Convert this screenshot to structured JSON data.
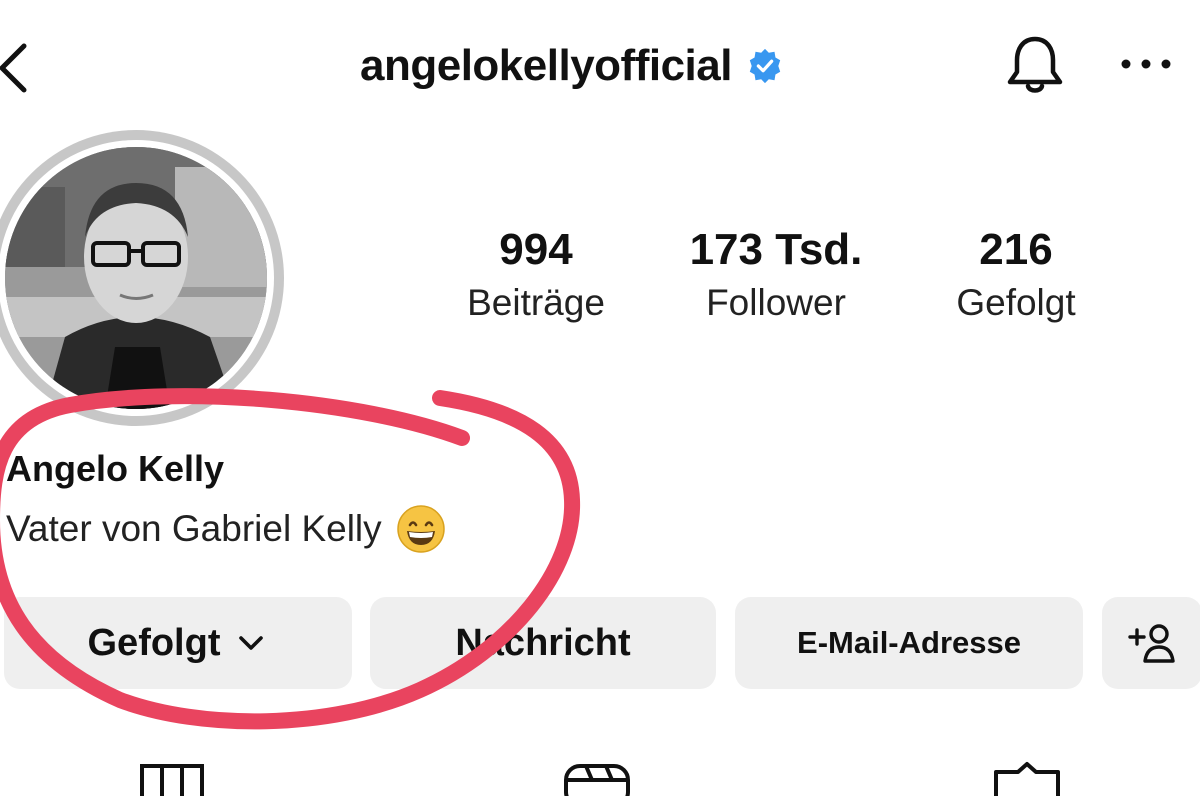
{
  "header": {
    "username": "angelokellyofficial",
    "icons": [
      "back-icon",
      "verified-badge-icon",
      "bell-icon",
      "more-icon"
    ]
  },
  "stats": [
    {
      "value": "994",
      "label": "Beiträge"
    },
    {
      "value": "173 Tsd.",
      "label": "Follower"
    },
    {
      "value": "216",
      "label": "Gefolgt"
    }
  ],
  "profile": {
    "name": "Angelo Kelly",
    "bio": "Vater von Gabriel Kelly",
    "bio_emoji": "grinning-face-icon"
  },
  "actions": {
    "follow_label": "Gefolgt",
    "message_label": "Nachricht",
    "email_label": "E-Mail-Adresse",
    "add_user_icon": "add-user-icon"
  },
  "tabs": [
    "grid-icon",
    "reels-icon",
    "tagged-icon"
  ],
  "colors": {
    "marker": "#e9445f",
    "verified": "#3897f0",
    "button_bg": "#efefef",
    "ring": "#c7c7c7"
  }
}
